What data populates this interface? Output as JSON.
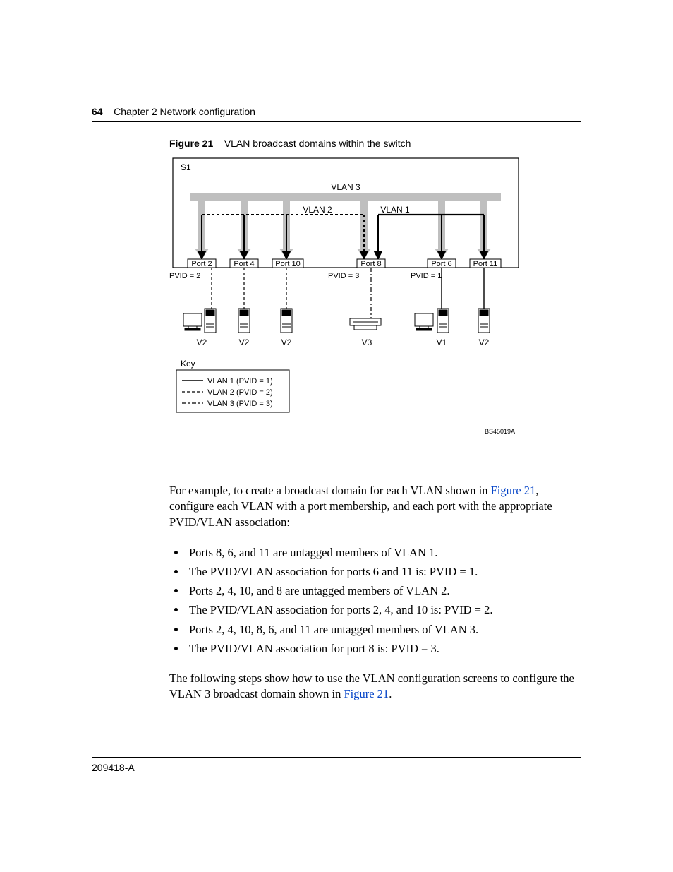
{
  "header": {
    "page_number": "64",
    "chapter": "Chapter 2  Network configuration"
  },
  "figure": {
    "label": "Figure 21",
    "caption": "VLAN broadcast domains within the switch",
    "switch_label": "S1",
    "vlan_bus_top": "VLAN 3",
    "vlan_label_left": "VLAN 2",
    "vlan_label_right": "VLAN 1",
    "ports": [
      "Port 2",
      "Port 4",
      "Port 10",
      "Port 8",
      "Port 6",
      "Port 11"
    ],
    "pvids": [
      "PVID = 2",
      "PVID = 3",
      "PVID = 1"
    ],
    "host_labels": [
      "V2",
      "V2",
      "V2",
      "V3",
      "V1",
      "V2"
    ],
    "key_title": "Key",
    "key_items": [
      "VLAN 1 (PVID = 1)",
      "VLAN 2 (PVID = 2)",
      "VLAN 3 (PVID = 3)"
    ],
    "ref_code": "BS45019A"
  },
  "para1_a": "For example, to create a broadcast domain for each VLAN shown in ",
  "para1_link": "Figure 21",
  "para1_b": ", configure each VLAN with a port membership, and each port with the appropriate PVID/VLAN association:",
  "bullets": [
    "Ports 8, 6, and 11 are untagged members of VLAN 1.",
    "The PVID/VLAN association for ports 6 and 11 is: PVID = 1.",
    "Ports 2, 4, 10, and 8 are untagged members of VLAN 2.",
    "The PVID/VLAN association for ports 2, 4, and 10 is: PVID = 2.",
    "Ports 2, 4, 10, 8, 6, and 11 are untagged members of VLAN 3.",
    "The PVID/VLAN association for port 8 is: PVID = 3."
  ],
  "para2_a": "The following steps show how to use the VLAN configuration screens to configure the VLAN 3 broadcast domain shown in ",
  "para2_link": "Figure 21",
  "para2_b": ".",
  "footer": {
    "doc_id": "209418-A"
  }
}
